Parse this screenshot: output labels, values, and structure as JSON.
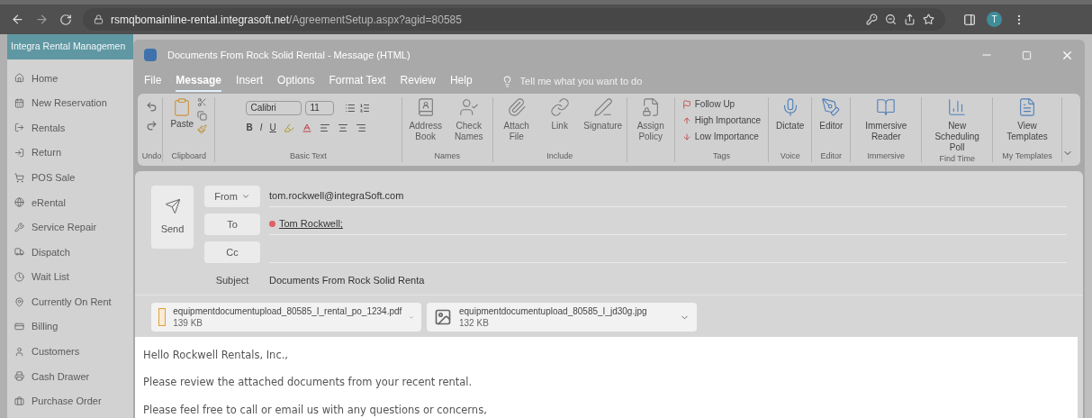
{
  "browser": {
    "url_host": "rsmqbomainline-rental.integrasoft.net",
    "url_path": "/AgreementSetup.aspx?agid=80585",
    "profile_initial": "T"
  },
  "sidebar": {
    "title": "Integra Rental Managemen",
    "items": [
      {
        "label": "Home"
      },
      {
        "label": "New Reservation"
      },
      {
        "label": "Rentals"
      },
      {
        "label": "Return"
      },
      {
        "label": "POS Sale"
      },
      {
        "label": "eRental"
      },
      {
        "label": "Service Repair"
      },
      {
        "label": "Dispatch"
      },
      {
        "label": "Wait List"
      },
      {
        "label": "Currently On Rent"
      },
      {
        "label": "Billing"
      },
      {
        "label": "Customers"
      },
      {
        "label": "Cash Drawer"
      },
      {
        "label": "Purchase Order"
      }
    ]
  },
  "window": {
    "title": "Documents From Rock Solid Rental  -  Message (HTML)"
  },
  "menu_tabs": [
    {
      "label": "File",
      "selected": false
    },
    {
      "label": "Message",
      "selected": true
    },
    {
      "label": "Insert",
      "selected": false
    },
    {
      "label": "Options",
      "selected": false
    },
    {
      "label": "Format Text",
      "selected": false
    },
    {
      "label": "Review",
      "selected": false
    },
    {
      "label": "Help",
      "selected": false
    }
  ],
  "tell_me": {
    "placeholder": "Tell me what you want to do"
  },
  "ribbon": {
    "undo_group": "Undo",
    "clipboard": {
      "paste": "Paste",
      "label": "Clipboard"
    },
    "basic_text": {
      "font": "Calibri",
      "size": "11",
      "bold": "B",
      "italic": "I",
      "underline": "U",
      "label": "Basic Text"
    },
    "names": {
      "buttons": [
        "Address Book",
        "Check Names"
      ],
      "label": "Names"
    },
    "include": {
      "buttons": [
        "Attach File",
        "Link",
        "Signature"
      ],
      "label": "Include"
    },
    "policy": {
      "buttons": [
        "Assign Policy"
      ]
    },
    "tags": {
      "items": [
        "Follow Up",
        "High Importance",
        "Low Importance"
      ],
      "label": "Tags"
    },
    "groups": [
      {
        "button": "Dictate",
        "label": "Voice"
      },
      {
        "button": "Editor",
        "label": "Editor"
      },
      {
        "button": "Immersive Reader",
        "label": "Immersive"
      },
      {
        "button": "New Scheduling Poll",
        "label": "Find Time"
      },
      {
        "button": "View Templates",
        "label": "My Templates"
      }
    ]
  },
  "compose": {
    "send": "Send",
    "from_button": "From",
    "from_value": "tom.rockwell@integraSoft.com",
    "to_button": "To",
    "to_recipient": "Tom Rockwell;",
    "cc_button": "Cc",
    "subject_label": "Subject",
    "subject_value": "Documents From Rock Solid Renta",
    "attachments": [
      {
        "name": "equipmentdocumentupload_80585_I_rental_po_1234.pdf",
        "size": "139 KB",
        "kind": "pdf"
      },
      {
        "name": "equipmentdocumentupload_80585_I_jd30g.jpg",
        "size": "132 KB",
        "kind": "image"
      }
    ],
    "body": [
      "Hello Rockwell Rentals, Inc.,",
      "Please review the attached documents from your recent rental.",
      "Please feel free to call or email us with any questions or concerns,"
    ]
  }
}
